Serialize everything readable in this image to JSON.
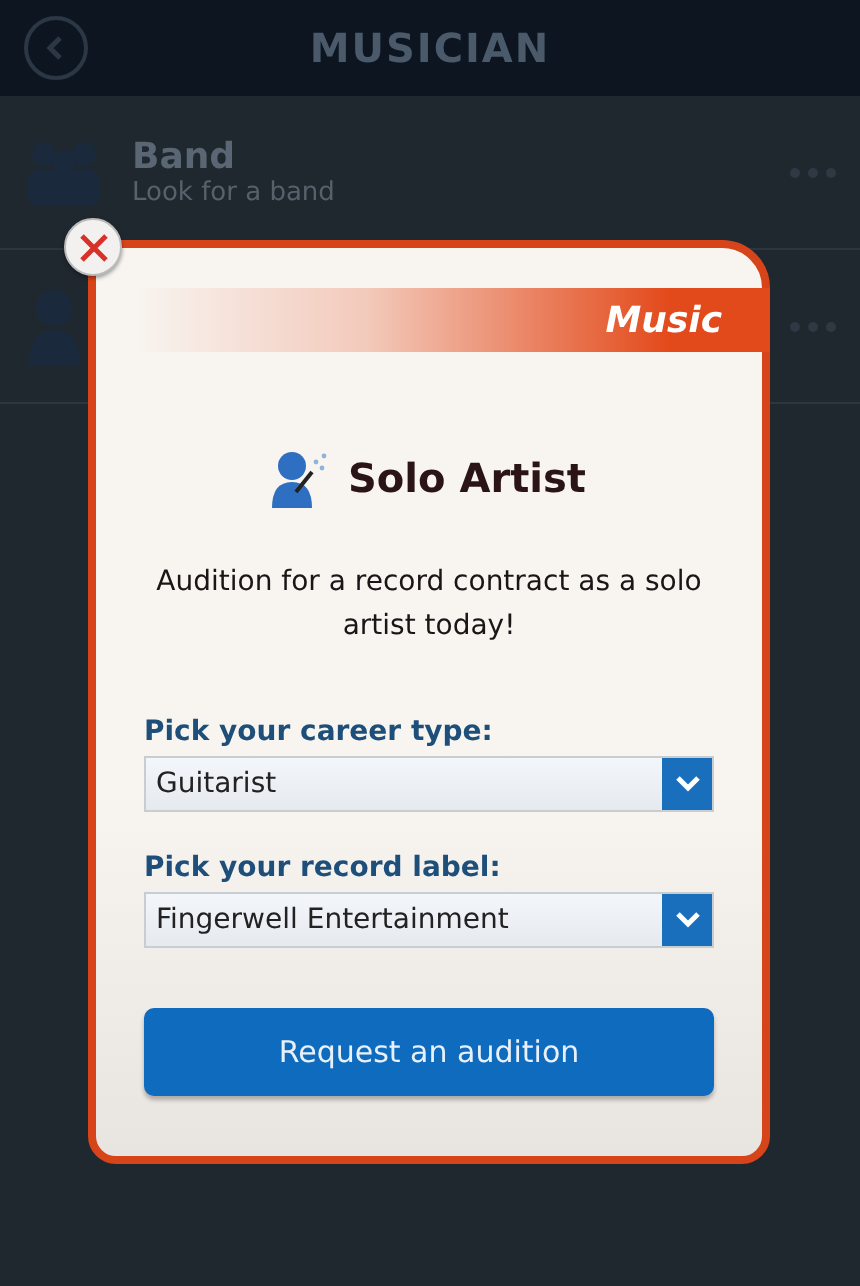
{
  "header": {
    "title": "MUSICIAN"
  },
  "list": [
    {
      "kind": "group",
      "title": "Band",
      "subtitle": "Look for a band"
    },
    {
      "kind": "person"
    }
  ],
  "dialog": {
    "category": "Music",
    "title": "Solo Artist",
    "description": "Audition for a record contract as a solo artist today!",
    "fields": [
      {
        "label": "Pick your career type:",
        "value": "Guitarist"
      },
      {
        "label": "Pick your record label:",
        "value": "Fingerwell Entertainment"
      }
    ],
    "button": "Request an audition"
  }
}
